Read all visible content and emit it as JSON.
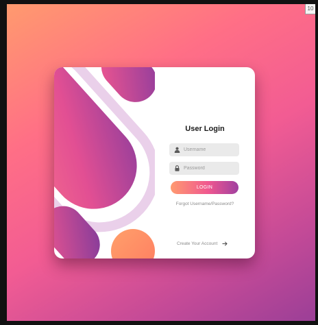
{
  "window": {
    "corner_badge": "10"
  },
  "login": {
    "title": "User Login",
    "username_placeholder": "Username",
    "password_placeholder": "Password",
    "login_label": "LOGIN",
    "forgot_label": "Forgot Username/Password?",
    "create_label": "Create Your Account"
  },
  "icons": {
    "username": "user-icon",
    "password": "lock-icon",
    "create": "arrow-right-icon"
  },
  "colors": {
    "gradient_start": "#ff9a6e",
    "gradient_mid": "#f25c93",
    "gradient_end": "#9b3f97",
    "ring": "#ead0ea",
    "text_dark": "#1a1a1a",
    "muted": "#8a8a8a",
    "field_bg": "#eaeaea"
  }
}
